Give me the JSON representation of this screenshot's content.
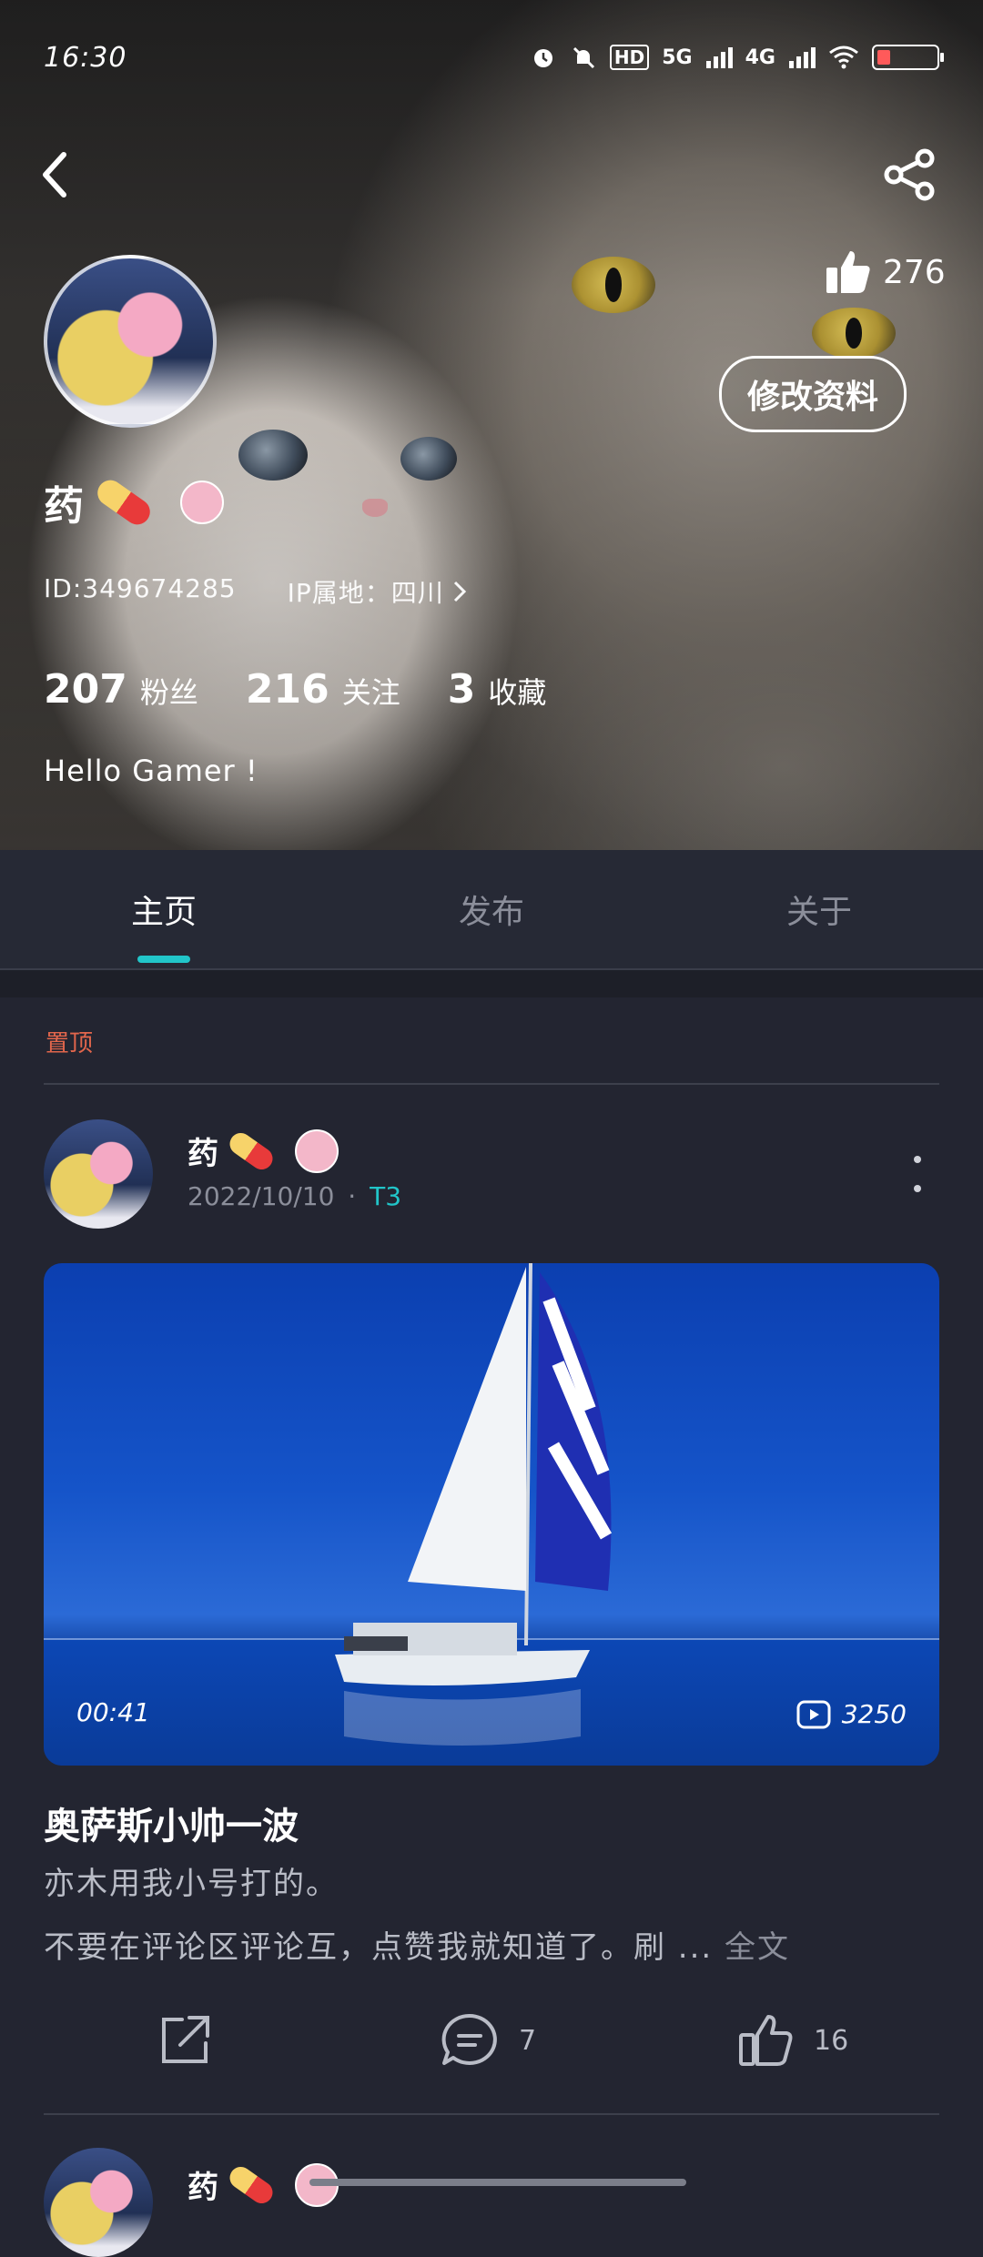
{
  "status_bar": {
    "time": "16:30",
    "icons": [
      "alarm-icon",
      "mute-icon",
      "hd-icon",
      "5g-signal-icon",
      "4g-signal-icon",
      "wifi-icon",
      "battery-icon"
    ],
    "hd_label": "HD",
    "net1": "5G",
    "net2": "4G"
  },
  "profile": {
    "likes": "276",
    "edit_label": "修改资料",
    "name": "药",
    "id_text": "ID:349674285",
    "ip_text": "IP属地：四川",
    "fans_count": "207",
    "fans_label": "粉丝",
    "follow_count": "216",
    "follow_label": "关注",
    "fav_count": "3",
    "fav_label": "收藏",
    "bio": "Hello Gamer !"
  },
  "tabs": [
    {
      "label": "主页",
      "active": true
    },
    {
      "label": "发布",
      "active": false
    },
    {
      "label": "关于",
      "active": false
    }
  ],
  "feed": {
    "pinned_label": "置顶",
    "post": {
      "author": "药",
      "date": "2022/10/10",
      "separator": "·",
      "game": "T3",
      "video_duration": "00:41",
      "video_views": "3250",
      "title": "奥萨斯小帅一波",
      "line1": "亦木用我小号打的。",
      "line2": "不要在评论区评论互，点赞我就知道了。刷 ...",
      "more_label": "全文",
      "comments": "7",
      "likes": "16"
    },
    "next_post_author": "药"
  },
  "colors": {
    "accent": "#21c5c9",
    "pinned": "#e2664c",
    "background": "#232531"
  }
}
